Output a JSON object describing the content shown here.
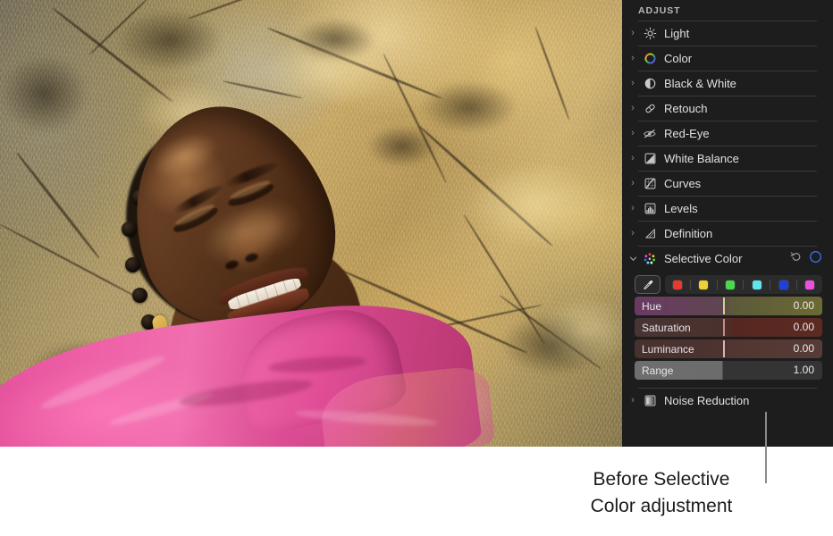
{
  "app": {
    "panel_title": "ADJUST",
    "background_color": "#1d1d1d"
  },
  "photo": {
    "alt": "Woman in pink sheer top lying against a sunlit golden rock face",
    "skin_color": "#613a20",
    "rock_color": "#b9a06a",
    "garment_color": "#ee5fa6"
  },
  "adjustments": [
    {
      "label": "Light",
      "icon": "sun-icon",
      "expanded": false,
      "chevron": "›"
    },
    {
      "label": "Color",
      "icon": "color-wheel-icon",
      "expanded": false,
      "chevron": "›"
    },
    {
      "label": "Black & White",
      "icon": "half-circle-icon",
      "expanded": false,
      "chevron": "›"
    },
    {
      "label": "Retouch",
      "icon": "bandage-icon",
      "expanded": false,
      "chevron": "›"
    },
    {
      "label": "Red-Eye",
      "icon": "eye-slash-icon",
      "expanded": false,
      "chevron": "›"
    },
    {
      "label": "White Balance",
      "icon": "white-balance-icon",
      "expanded": false,
      "chevron": "›"
    },
    {
      "label": "Curves",
      "icon": "curves-icon",
      "expanded": false,
      "chevron": "›"
    },
    {
      "label": "Levels",
      "icon": "levels-icon",
      "expanded": false,
      "chevron": "›"
    },
    {
      "label": "Definition",
      "icon": "definition-icon",
      "expanded": false,
      "chevron": "›"
    }
  ],
  "selective_color": {
    "label": "Selective Color",
    "icon": "selective-color-dots-icon",
    "chevron": "⌄",
    "expanded": true,
    "reset_icon": "reset-arrow-icon",
    "toggle_icon": "enable-circle-icon",
    "toggle_color": "#3a6ee8",
    "eyedropper_icon": "eyedropper-icon",
    "swatches": [
      {
        "name": "red-swatch",
        "color": "#e8392c"
      },
      {
        "name": "yellow-swatch",
        "color": "#ecd133"
      },
      {
        "name": "green-swatch",
        "color": "#4ad84f"
      },
      {
        "name": "cyan-swatch",
        "color": "#5fe5ec"
      },
      {
        "name": "blue-swatch",
        "color": "#1f3fe0"
      },
      {
        "name": "magenta-swatch",
        "color": "#ed4fe0"
      }
    ],
    "sliders": [
      {
        "name": "Hue",
        "value": "0.00",
        "fill_percent": 47,
        "gradient_from": "#6b3a63",
        "gradient_mid": "#5e4650",
        "gradient_to": "#6b6a32",
        "knob_color": "#d4d08a"
      },
      {
        "name": "Saturation",
        "value": "0.00",
        "fill_percent": 47,
        "gradient_from": "#4a3533",
        "gradient_mid": "#4d332f",
        "gradient_to": "#5d2a22",
        "knob_color": "#c88c80"
      },
      {
        "name": "Luminance",
        "value": "0.00",
        "fill_percent": 47,
        "gradient_from": "#4b3230",
        "gradient_mid": "#4e3633",
        "gradient_to": "#553a36",
        "knob_color": "#d6b8b0"
      },
      {
        "name": "Range",
        "value": "1.00",
        "fill_percent": 47,
        "gradient_from": "#6e6e6e",
        "gradient_mid": "#6a6a6a",
        "gradient_to": "#343434",
        "knob_color": "#6e6e6e"
      }
    ]
  },
  "noise_reduction": {
    "label": "Noise Reduction",
    "icon": "noise-reduction-icon",
    "chevron": "›",
    "expanded": false
  },
  "caption": {
    "line1": "Before Selective",
    "line2": "Color adjustment",
    "callout_color": "#8a8a8a"
  }
}
